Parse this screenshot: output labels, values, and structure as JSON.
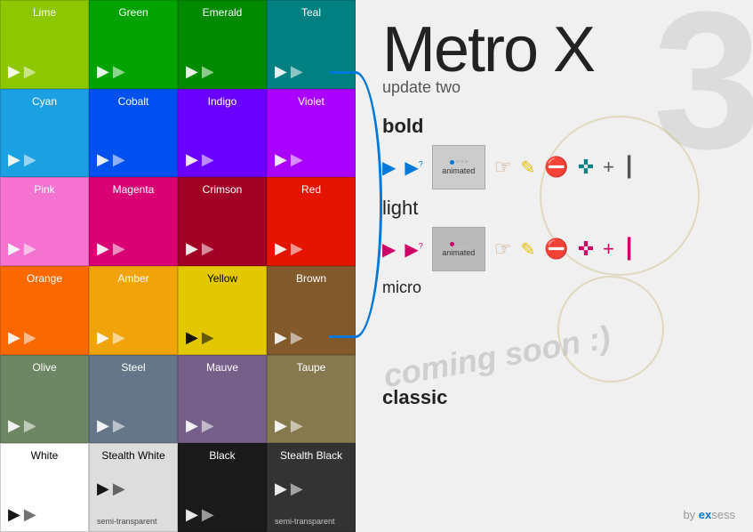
{
  "title": "Metro X update two",
  "watermark": "3",
  "subtitle": "update two",
  "sections": {
    "bold": "bold",
    "light": "light",
    "micro": "micro",
    "classic": "classic"
  },
  "comingSoon": "coming soon :)",
  "byLine": "by exsess",
  "animated": "animated",
  "tiles": [
    {
      "label": "Lime",
      "color": "#8cc700",
      "textColor": "white"
    },
    {
      "label": "Green",
      "color": "#00a300",
      "textColor": "white"
    },
    {
      "label": "Emerald",
      "color": "#008a00",
      "textColor": "white"
    },
    {
      "label": "Teal",
      "color": "#008080",
      "textColor": "white"
    },
    {
      "label": "Cyan",
      "color": "#1ba1e2",
      "textColor": "white"
    },
    {
      "label": "Cobalt",
      "color": "#0050ef",
      "textColor": "white"
    },
    {
      "label": "Indigo",
      "color": "#6a00ff",
      "textColor": "white"
    },
    {
      "label": "Violet",
      "color": "#aa00ff",
      "textColor": "white"
    },
    {
      "label": "Pink",
      "color": "#f472d0",
      "textColor": "white"
    },
    {
      "label": "Magenta",
      "color": "#d80073",
      "textColor": "white"
    },
    {
      "label": "Crimson",
      "color": "#a20025",
      "textColor": "white"
    },
    {
      "label": "Red",
      "color": "#e51400",
      "textColor": "white"
    },
    {
      "label": "Orange",
      "color": "#fa6800",
      "textColor": "white"
    },
    {
      "label": "Amber",
      "color": "#f0a30a",
      "textColor": "white"
    },
    {
      "label": "Yellow",
      "color": "#e3c800",
      "textColor": "black"
    },
    {
      "label": "Brown",
      "color": "#825a2c",
      "textColor": "white"
    },
    {
      "label": "Olive",
      "color": "#6d8764",
      "textColor": "white"
    },
    {
      "label": "Steel",
      "color": "#647687",
      "textColor": "white"
    },
    {
      "label": "Mauve",
      "color": "#76608a",
      "textColor": "white"
    },
    {
      "label": "Taupe",
      "color": "#87794e",
      "textColor": "white"
    },
    {
      "label": "White",
      "color": "#ffffff",
      "textColor": "black"
    },
    {
      "label": "Stealth White",
      "color": "#dddddd",
      "textColor": "black",
      "note": "semi-transparent"
    },
    {
      "label": "Black",
      "color": "#1a1a1a",
      "textColor": "white"
    },
    {
      "label": "Stealth Black",
      "color": "#333333",
      "textColor": "white",
      "note": "semi-transparent"
    }
  ]
}
